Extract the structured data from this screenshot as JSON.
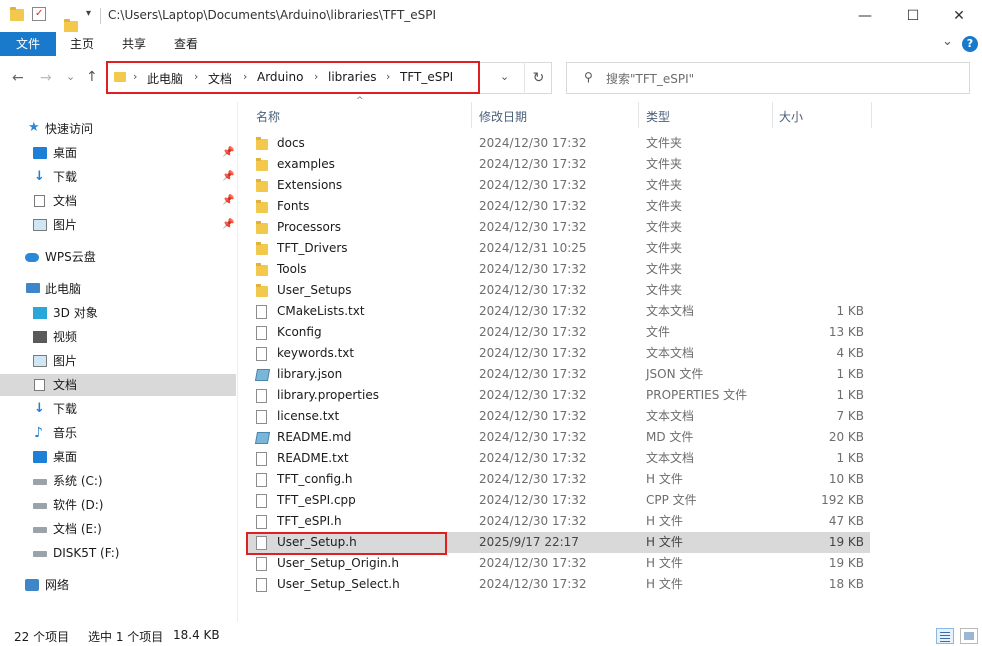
{
  "window": {
    "path": "C:\\Users\\Laptop\\Documents\\Arduino\\libraries\\TFT_eSPI",
    "minimize": "—",
    "maximize": "☐",
    "close": "✕"
  },
  "ribbon": {
    "tabs": [
      "文件",
      "主页",
      "共享",
      "查看"
    ],
    "help": "?",
    "collapse": "⌄"
  },
  "nav": {
    "back": "←",
    "forward": "→",
    "recent": "⌄",
    "up": "↑",
    "breadcrumbs": [
      "此电脑",
      "文档",
      "Arduino",
      "libraries",
      "TFT_eSPI"
    ],
    "crumb_separator": "›",
    "dropdown": "⌄",
    "refresh": "↻",
    "search_placeholder": "搜索\"TFT_eSPI\"",
    "search_icon": "magnifier-icon"
  },
  "sidebar": {
    "items": [
      {
        "label": "快速访问",
        "icon": "star-icon",
        "pinned": false
      },
      {
        "label": "桌面",
        "icon": "desktop-icon",
        "pinned": true
      },
      {
        "label": "下载",
        "icon": "download-icon",
        "pinned": true
      },
      {
        "label": "文档",
        "icon": "document-icon",
        "pinned": true
      },
      {
        "label": "图片",
        "icon": "picture-icon",
        "pinned": true
      },
      {
        "label": "WPS云盘",
        "icon": "cloud-icon",
        "pinned": false
      },
      {
        "label": "此电脑",
        "icon": "computer-icon",
        "pinned": false
      },
      {
        "label": "3D 对象",
        "icon": "cube-icon",
        "pinned": false
      },
      {
        "label": "视频",
        "icon": "video-icon",
        "pinned": false
      },
      {
        "label": "图片",
        "icon": "picture-icon",
        "pinned": false
      },
      {
        "label": "文档",
        "icon": "document-icon",
        "pinned": false,
        "selected": true
      },
      {
        "label": "下载",
        "icon": "download-icon",
        "pinned": false
      },
      {
        "label": "音乐",
        "icon": "music-icon",
        "pinned": false
      },
      {
        "label": "桌面",
        "icon": "desktop-icon",
        "pinned": false
      },
      {
        "label": "系统 (C:)",
        "icon": "drive-icon",
        "pinned": false
      },
      {
        "label": "软件 (D:)",
        "icon": "drive-icon",
        "pinned": false
      },
      {
        "label": "文档 (E:)",
        "icon": "drive-icon",
        "pinned": false
      },
      {
        "label": "DISK5T (F:)",
        "icon": "drive-icon",
        "pinned": false
      },
      {
        "label": "网络",
        "icon": "network-icon",
        "pinned": false
      }
    ]
  },
  "columns": {
    "name": "名称",
    "date": "修改日期",
    "type": "类型",
    "size": "大小"
  },
  "files": [
    {
      "name": "docs",
      "date": "2024/12/30 17:32",
      "type": "文件夹",
      "size": "",
      "kind": "folder"
    },
    {
      "name": "examples",
      "date": "2024/12/30 17:32",
      "type": "文件夹",
      "size": "",
      "kind": "folder"
    },
    {
      "name": "Extensions",
      "date": "2024/12/30 17:32",
      "type": "文件夹",
      "size": "",
      "kind": "folder"
    },
    {
      "name": "Fonts",
      "date": "2024/12/30 17:32",
      "type": "文件夹",
      "size": "",
      "kind": "folder"
    },
    {
      "name": "Processors",
      "date": "2024/12/30 17:32",
      "type": "文件夹",
      "size": "",
      "kind": "folder"
    },
    {
      "name": "TFT_Drivers",
      "date": "2024/12/31 10:25",
      "type": "文件夹",
      "size": "",
      "kind": "folder"
    },
    {
      "name": "Tools",
      "date": "2024/12/30 17:32",
      "type": "文件夹",
      "size": "",
      "kind": "folder"
    },
    {
      "name": "User_Setups",
      "date": "2024/12/30 17:32",
      "type": "文件夹",
      "size": "",
      "kind": "folder"
    },
    {
      "name": "CMakeLists.txt",
      "date": "2024/12/30 17:32",
      "type": "文本文档",
      "size": "1 KB",
      "kind": "file"
    },
    {
      "name": "Kconfig",
      "date": "2024/12/30 17:32",
      "type": "文件",
      "size": "13 KB",
      "kind": "file"
    },
    {
      "name": "keywords.txt",
      "date": "2024/12/30 17:32",
      "type": "文本文档",
      "size": "4 KB",
      "kind": "file"
    },
    {
      "name": "library.json",
      "date": "2024/12/30 17:32",
      "type": "JSON 文件",
      "size": "1 KB",
      "kind": "json"
    },
    {
      "name": "library.properties",
      "date": "2024/12/30 17:32",
      "type": "PROPERTIES 文件",
      "size": "1 KB",
      "kind": "file"
    },
    {
      "name": "license.txt",
      "date": "2024/12/30 17:32",
      "type": "文本文档",
      "size": "7 KB",
      "kind": "file"
    },
    {
      "name": "README.md",
      "date": "2024/12/30 17:32",
      "type": "MD 文件",
      "size": "20 KB",
      "kind": "json"
    },
    {
      "name": "README.txt",
      "date": "2024/12/30 17:32",
      "type": "文本文档",
      "size": "1 KB",
      "kind": "file"
    },
    {
      "name": "TFT_config.h",
      "date": "2024/12/30 17:32",
      "type": "H 文件",
      "size": "10 KB",
      "kind": "file"
    },
    {
      "name": "TFT_eSPI.cpp",
      "date": "2024/12/30 17:32",
      "type": "CPP 文件",
      "size": "192 KB",
      "kind": "file"
    },
    {
      "name": "TFT_eSPI.h",
      "date": "2024/12/30 17:32",
      "type": "H 文件",
      "size": "47 KB",
      "kind": "file"
    },
    {
      "name": "User_Setup.h",
      "date": "2025/9/17 22:17",
      "type": "H 文件",
      "size": "19 KB",
      "kind": "file",
      "selected": true
    },
    {
      "name": "User_Setup_Origin.h",
      "date": "2024/12/30 17:32",
      "type": "H 文件",
      "size": "19 KB",
      "kind": "file"
    },
    {
      "name": "User_Setup_Select.h",
      "date": "2024/12/30 17:32",
      "type": "H 文件",
      "size": "18 KB",
      "kind": "file"
    }
  ],
  "status": {
    "count": "22 个项目",
    "selection": "选中 1 个项目",
    "size": "18.4 KB"
  },
  "colors": {
    "accent": "#1979ca",
    "highlight_box": "#e02020",
    "selected_row": "#d9d9d9"
  }
}
